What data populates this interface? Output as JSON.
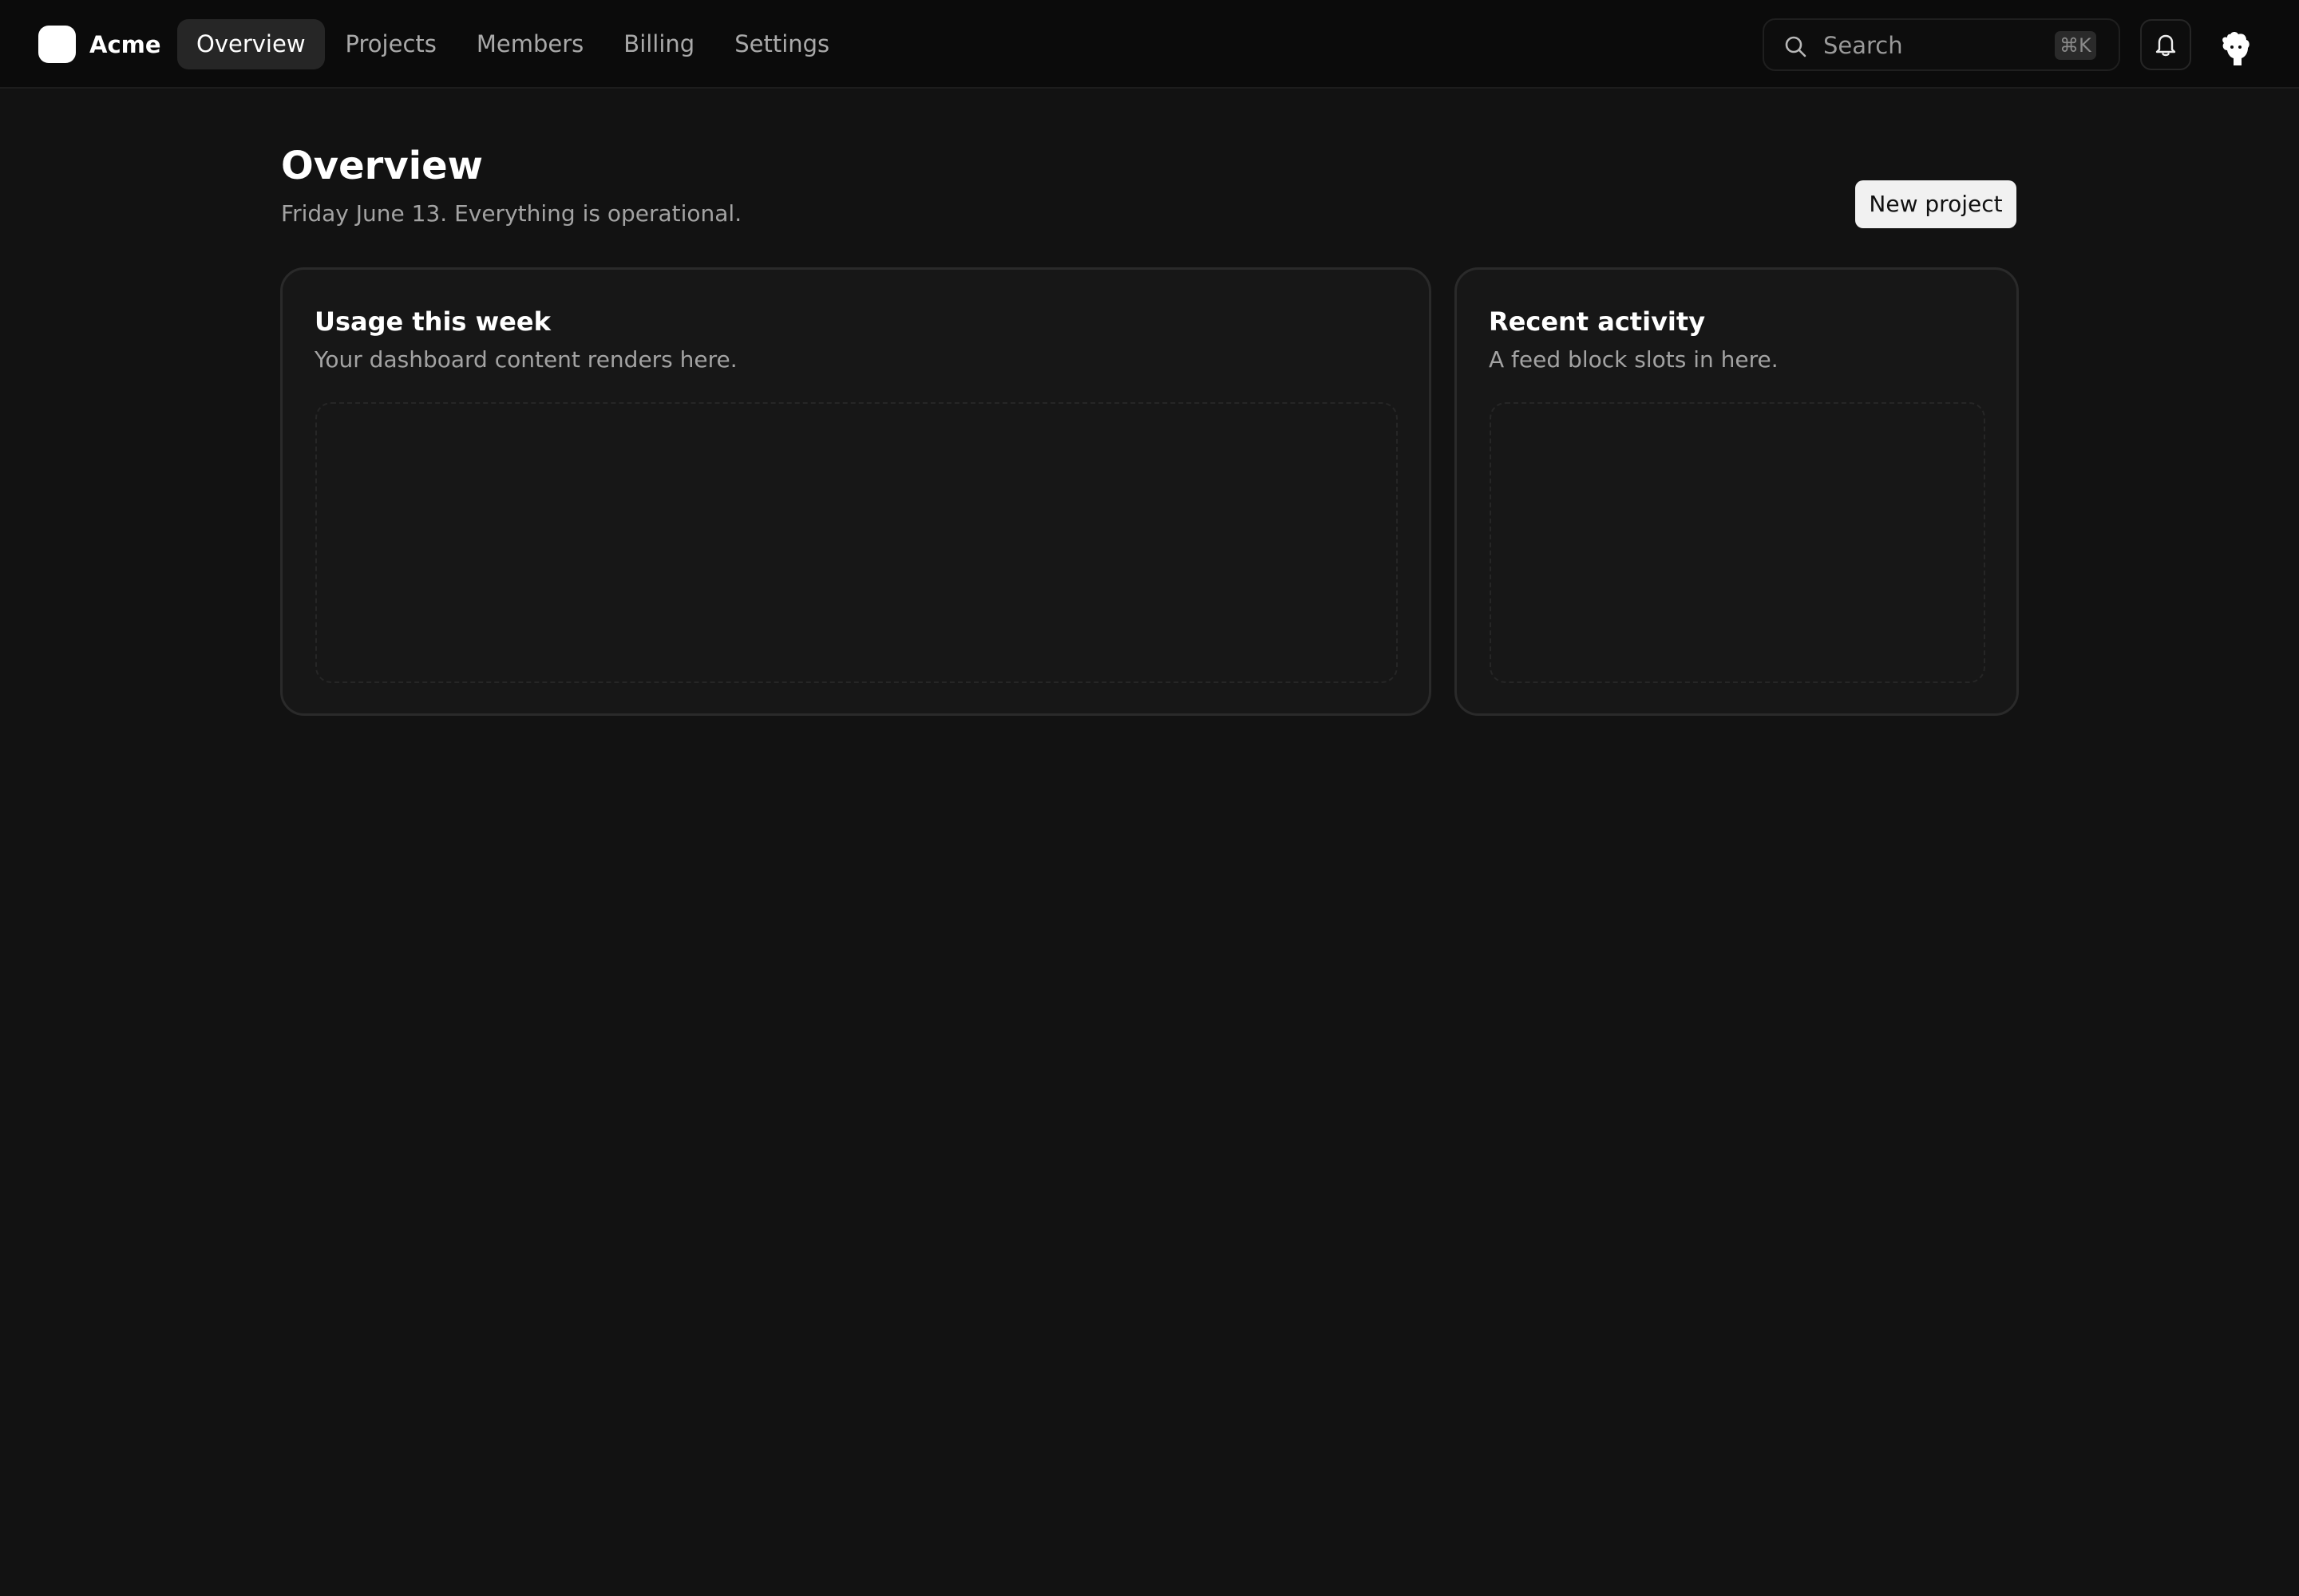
{
  "app": {
    "name": "Acme"
  },
  "nav": {
    "items": [
      {
        "label": "Overview",
        "active": true
      },
      {
        "label": "Projects",
        "active": false
      },
      {
        "label": "Members",
        "active": false
      },
      {
        "label": "Billing",
        "active": false
      },
      {
        "label": "Settings",
        "active": false
      }
    ]
  },
  "search": {
    "placeholder": "Search",
    "shortcut": "⌘K",
    "icon": "search-icon"
  },
  "header_actions": {
    "notifications_icon": "bell-icon",
    "avatar_icon": "avatar"
  },
  "page": {
    "title": "Overview",
    "subtitle": "Friday June 13. Everything is operational.",
    "primary_action": "New project"
  },
  "cards": [
    {
      "title": "Usage this week",
      "description": "Your dashboard content renders here."
    },
    {
      "title": "Recent activity",
      "description": "A feed block slots in here."
    }
  ],
  "colors": {
    "background": "#121212",
    "topbar": "#0b0b0b",
    "card": "#171717",
    "active_nav": "#262626",
    "button": "#f1f1f1"
  }
}
